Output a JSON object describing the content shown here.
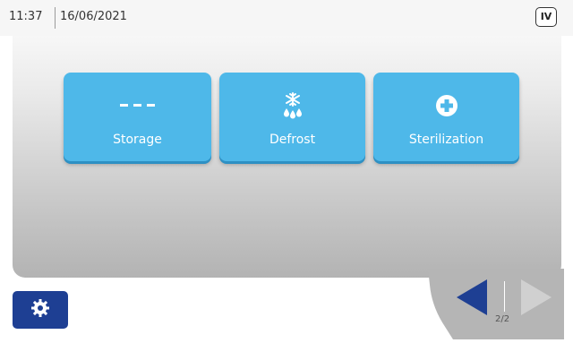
{
  "header": {
    "time": "11:37",
    "date": "16/06/2021",
    "badge": "IV"
  },
  "modes": [
    {
      "label": "Storage",
      "icon": "dashes-icon"
    },
    {
      "label": "Defrost",
      "icon": "snowflake-drops-icon"
    },
    {
      "label": "Sterilization",
      "icon": "plus-circle-icon"
    }
  ],
  "footer": {
    "settings_icon": "gear-icon",
    "page_indicator": "2/2"
  },
  "colors": {
    "button": "#4eb8e9",
    "settings": "#1e3f93",
    "nav_active": "#1e3f93",
    "nav_inactive": "#d0d0d0"
  }
}
